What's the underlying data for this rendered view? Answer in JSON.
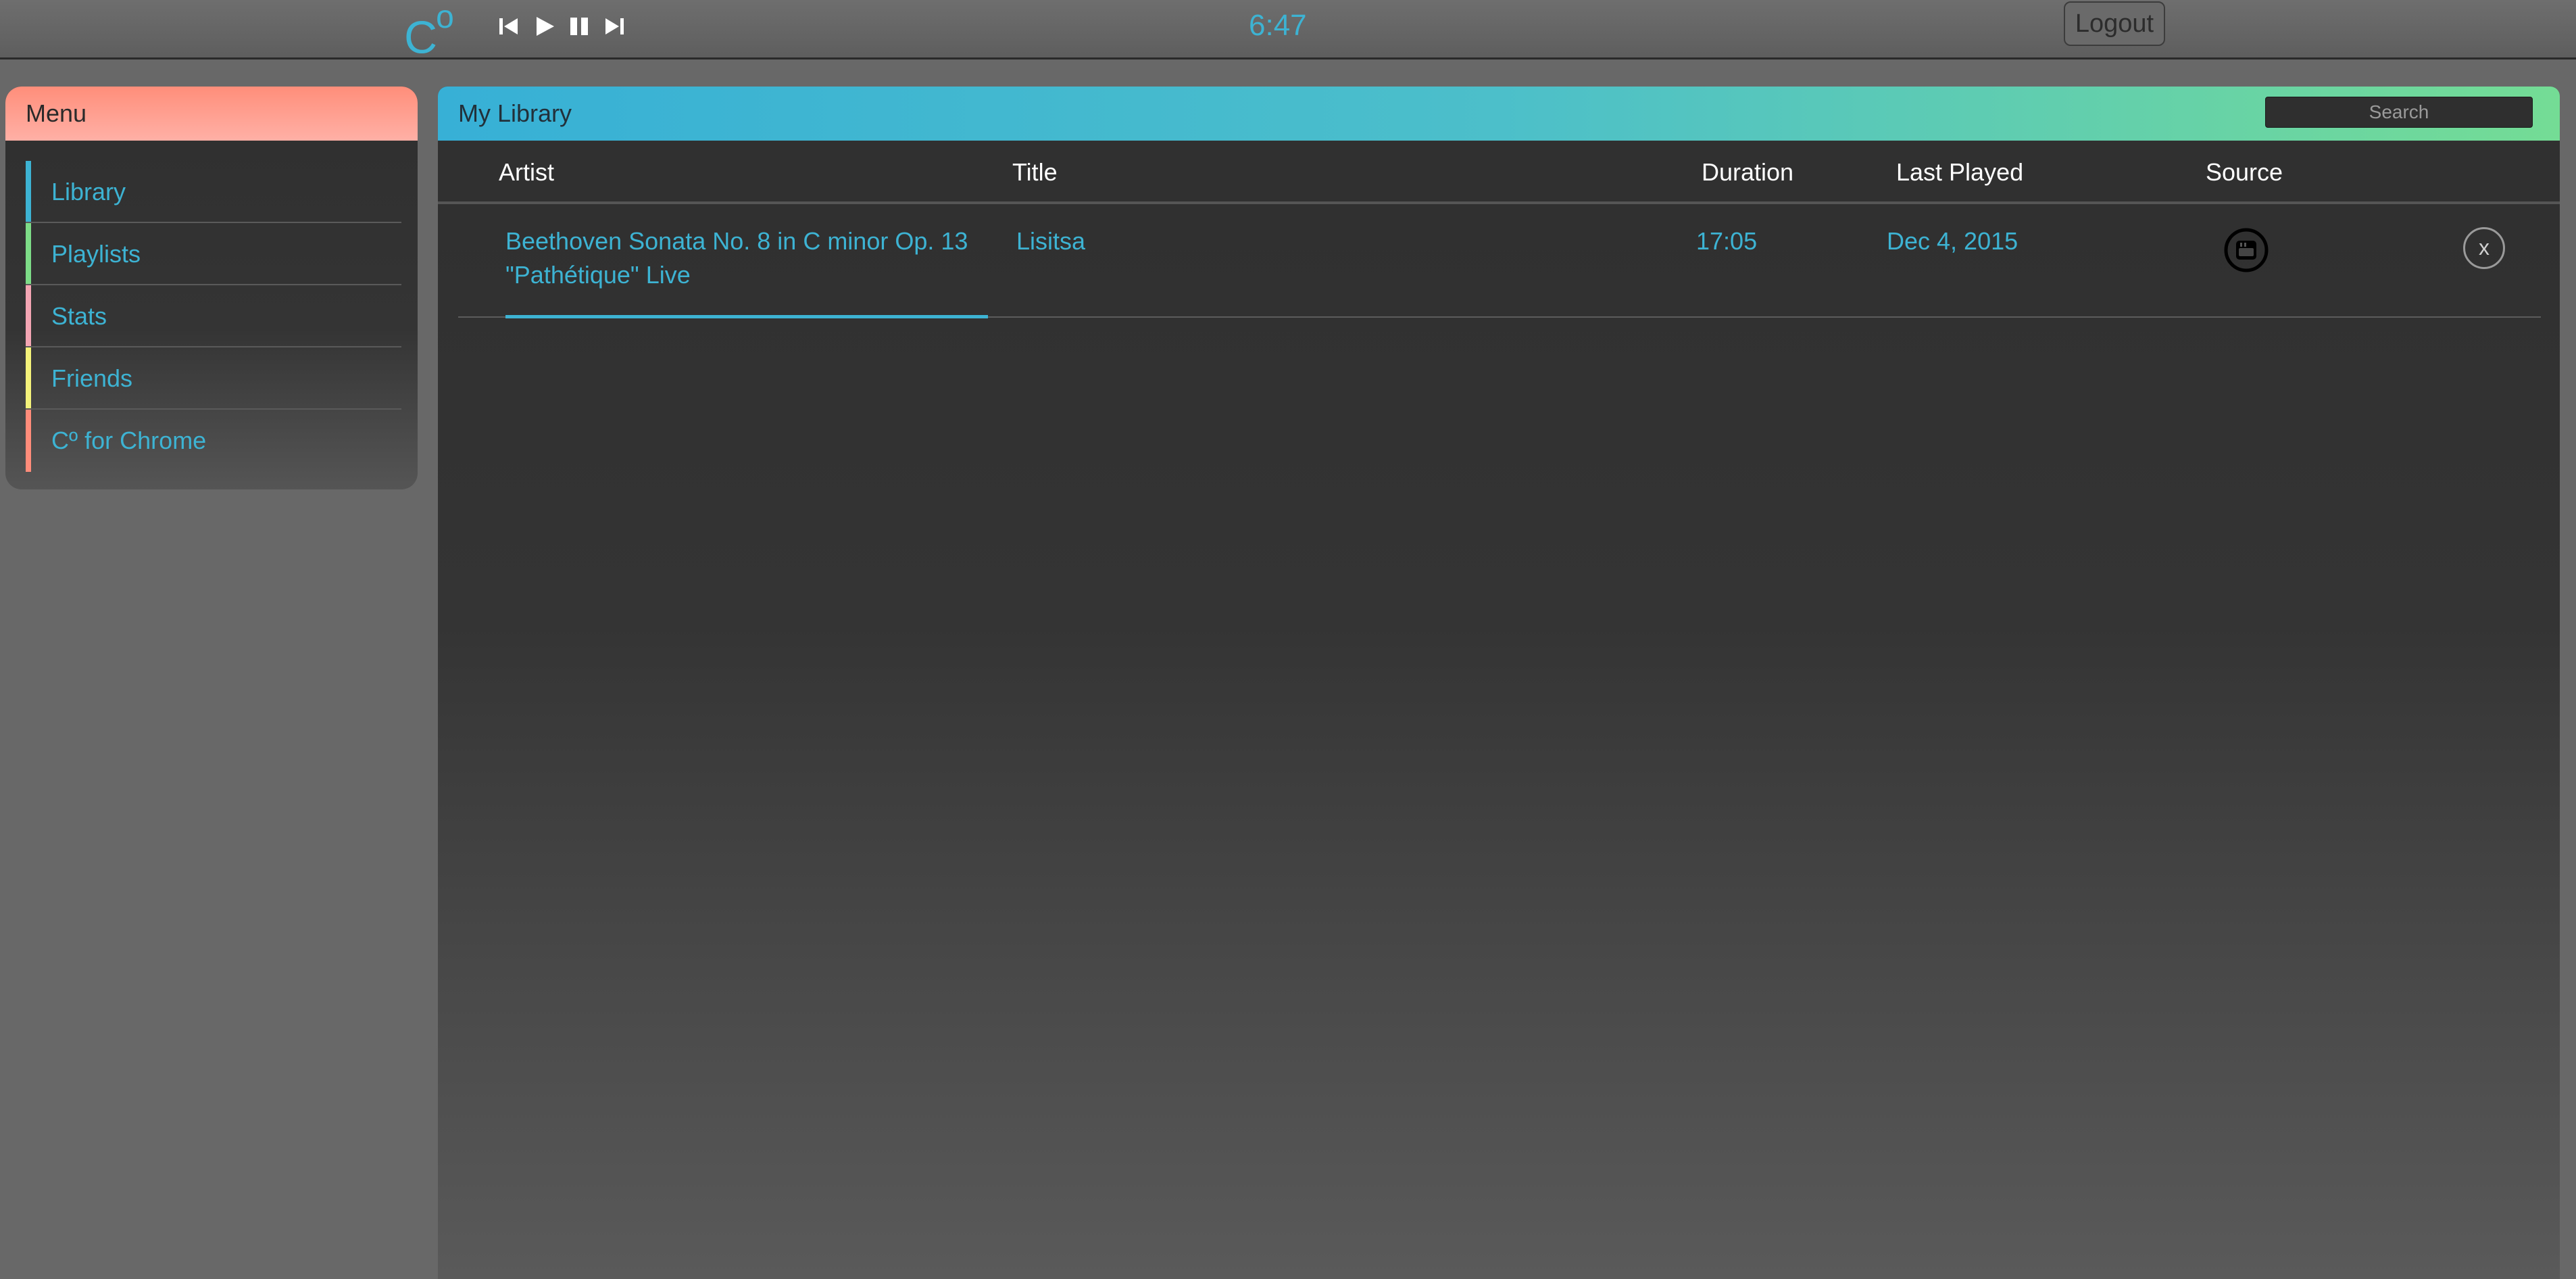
{
  "topbar": {
    "logo": "C",
    "logo_sup": "o",
    "time": "6:47",
    "logout_label": "Logout",
    "controls": [
      "previous-icon",
      "play-icon",
      "pause-icon",
      "next-icon"
    ]
  },
  "sidebar": {
    "title": "Menu",
    "items": [
      {
        "label": "Library",
        "color": "#3db3d3"
      },
      {
        "label": "Playlists",
        "color": "#7ddc87"
      },
      {
        "label": "Stats",
        "color": "#f3a5b3"
      },
      {
        "label": "Friends",
        "color": "#f4f27a"
      },
      {
        "label": "Cº for Chrome",
        "color": "#ff8c7a"
      }
    ]
  },
  "main": {
    "title": "My Library",
    "search_placeholder": "Search",
    "columns": [
      "Artist",
      "Title",
      "Duration",
      "Last Played",
      "Source"
    ],
    "rows": [
      {
        "artist": "Beethoven Sonata No. 8 in C minor Op. 13 \"Pathétique\" Live",
        "title": "Lisitsa",
        "duration": "17:05",
        "last_played": "Dec 4, 2015",
        "source": "youtube-icon",
        "remove": "x"
      }
    ]
  },
  "colors": {
    "accent": "#3db3d3",
    "menu_header": "#ff9c8c",
    "library_header_start": "#37b0d6",
    "library_header_end": "#74dc95"
  }
}
